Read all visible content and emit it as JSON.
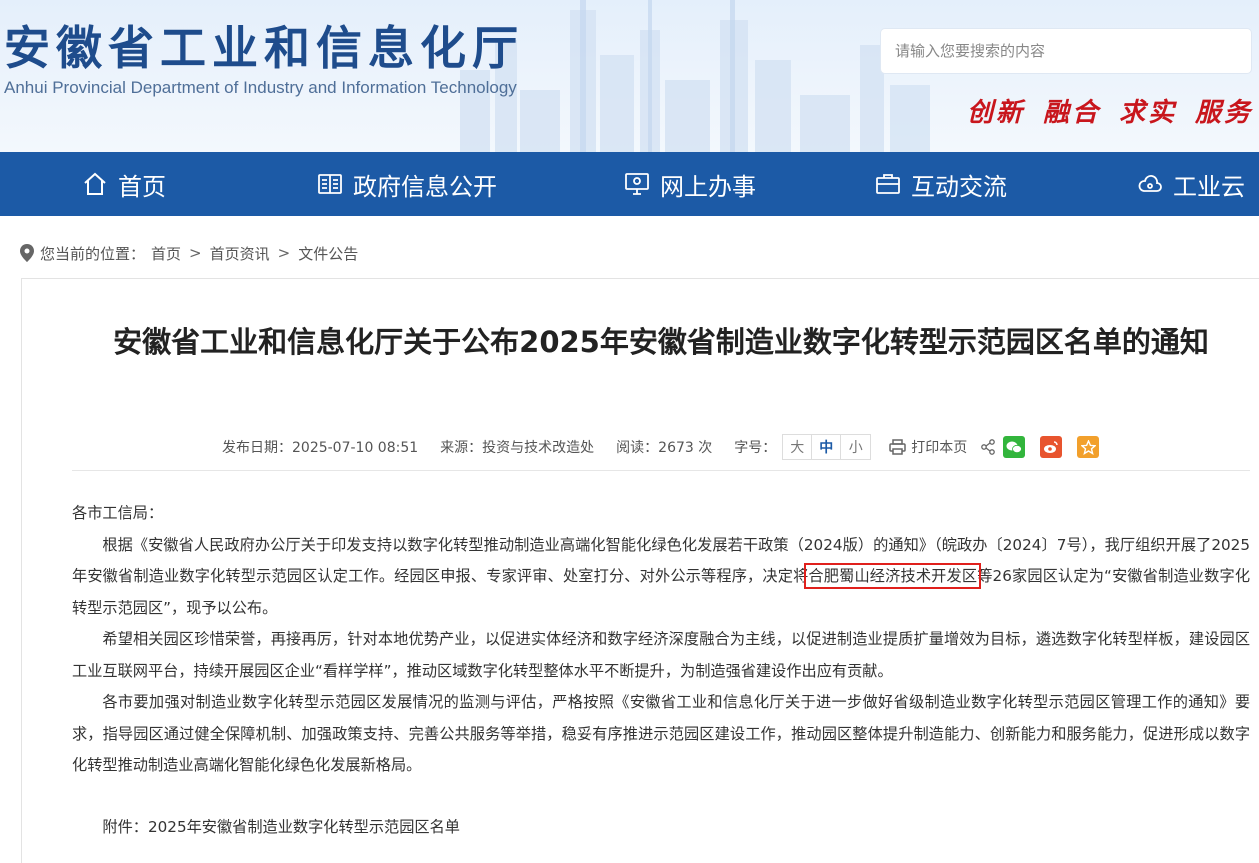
{
  "header": {
    "title": "安徽省工业和信息化厅",
    "subtitle": "Anhui Provincial Department of Industry and Information Technology",
    "search_placeholder": "请输入您要搜索的内容",
    "slogan": [
      "创新",
      "融合",
      "求实",
      "服务"
    ]
  },
  "nav": {
    "items": [
      {
        "label": "首页",
        "icon": "home-icon"
      },
      {
        "label": "政府信息公开",
        "icon": "book-icon"
      },
      {
        "label": "网上办事",
        "icon": "monitor-icon"
      },
      {
        "label": "互动交流",
        "icon": "briefcase-icon"
      },
      {
        "label": "工业云",
        "icon": "cloud-icon"
      }
    ]
  },
  "breadcrumb": {
    "prefix": "您当前的位置：",
    "items": [
      "首页",
      "首页资讯",
      "文件公告"
    ]
  },
  "article": {
    "title": "安徽省工业和信息化厅关于公布2025年安徽省制造业数字化转型示范园区名单的通知",
    "meta": {
      "date_label": "发布日期：2025-07-10 08:51",
      "source_label": "来源：投资与技术改造处",
      "views_label": "阅读：2673 次",
      "fontsize_label": "字号：",
      "sizes": [
        "大",
        "中",
        "小"
      ],
      "print_label": "打印本页"
    },
    "salutation": "各市工信局：",
    "p1_before": "根据《安徽省人民政府办公厅关于印发支持以数字化转型推动制造业高端化智能化绿色化发展若干政策（2024版）的通知》（皖政办〔2024〕7号），我厅组织开展了2025年安徽省制造业数字化转型示范园区认定工作。经园区申报、专家评审、处室打分、对外公示等程序，决定将",
    "p1_highlight": "合肥蜀山经济技术开发区",
    "p1_after": "等26家园区认定为“安徽省制造业数字化转型示范园区”，现予以公布。",
    "p2": "希望相关园区珍惜荣誉，再接再厉，针对本地优势产业，以促进实体经济和数字经济深度融合为主线，以促进制造业提质扩量增效为目标，遴选数字化转型样板，建设园区工业互联网平台，持续开展园区企业“看样学样”，推动区域数字化转型整体水平不断提升，为制造强省建设作出应有贡献。",
    "p3": "各市要加强对制造业数字化转型示范园区发展情况的监测与评估，严格按照《安徽省工业和信息化厅关于进一步做好省级制造业数字化转型示范园区管理工作的通知》要求，指导园区通过健全保障机制、加强政策支持、完善公共服务等举措，稳妥有序推进示范园区建设工作，推动园区整体提升制造能力、创新能力和服务能力，促进形成以数字化转型推动制造业高端化智能化绿色化发展新格局。",
    "attachment": "附件：2025年安徽省制造业数字化转型示范园区名单"
  },
  "colors": {
    "nav_bg": "#1c5aa6",
    "title_blue": "#1e4c8c",
    "slogan_red": "#c8161d",
    "highlight_red": "#e0201c"
  }
}
